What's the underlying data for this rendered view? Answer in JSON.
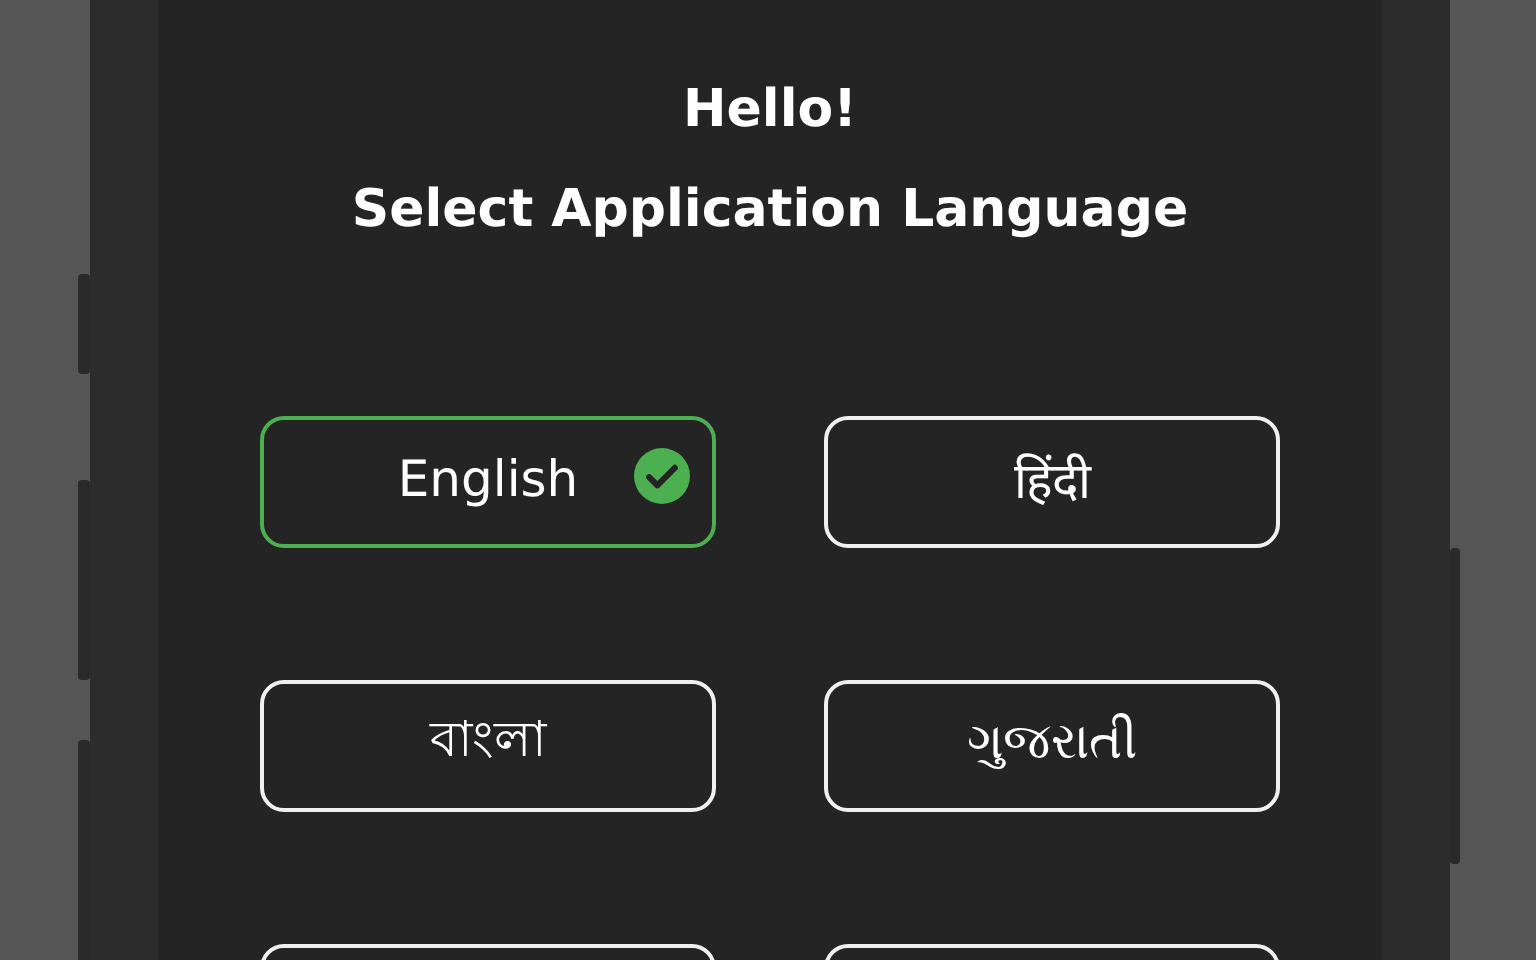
{
  "greeting": "Hello!",
  "title": "Select Application Language",
  "languages": [
    {
      "label": "English",
      "selected": true
    },
    {
      "label": "हिंदी",
      "selected": false
    },
    {
      "label": "বাংলা",
      "selected": false
    },
    {
      "label": "ગુજરાતી",
      "selected": false
    },
    {
      "selected": false
    },
    {
      "selected": false
    }
  ]
}
